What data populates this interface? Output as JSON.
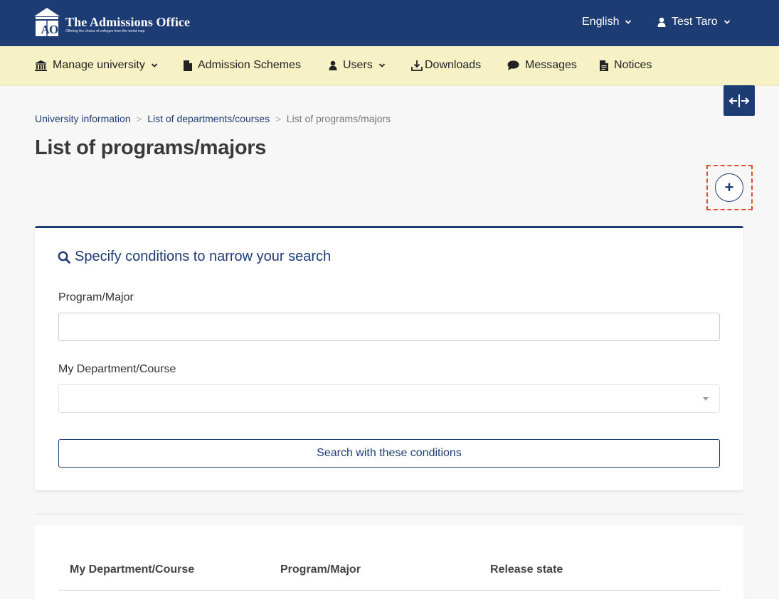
{
  "header": {
    "logo_title": "The Admissions Office",
    "logo_tagline": "Offering the choice of colleges from the world map",
    "logo_letters": "A O",
    "language": "English",
    "user_name": "Test Taro"
  },
  "nav": {
    "items": [
      {
        "label": "Manage university",
        "icon": "university-icon",
        "dropdown": true
      },
      {
        "label": "Admission Schemes",
        "icon": "file-icon",
        "dropdown": false
      },
      {
        "label": "Users",
        "icon": "user-icon",
        "dropdown": true
      },
      {
        "label": "Downloads",
        "icon": "download-icon",
        "dropdown": false
      },
      {
        "label": "Messages",
        "icon": "comment-icon",
        "dropdown": false
      },
      {
        "label": "Notices",
        "icon": "document-icon",
        "dropdown": false
      }
    ]
  },
  "breadcrumb": {
    "items": [
      "University information",
      "List of departments/courses",
      "List of programs/majors"
    ],
    "separator": ">"
  },
  "page": {
    "title": "List of programs/majors",
    "add_symbol": "+"
  },
  "search": {
    "heading": "Specify conditions to narrow your search",
    "program_label": "Program/Major",
    "program_value": "",
    "department_label": "My Department/Course",
    "department_value": "",
    "submit_label": "Search with these conditions"
  },
  "table": {
    "columns": [
      "My Department/Course",
      "Program/Major",
      "Release state"
    ]
  },
  "colors": {
    "primary": "#1e3c74",
    "nav_bg": "#f6f2c6",
    "highlight": "#e24a2b"
  }
}
